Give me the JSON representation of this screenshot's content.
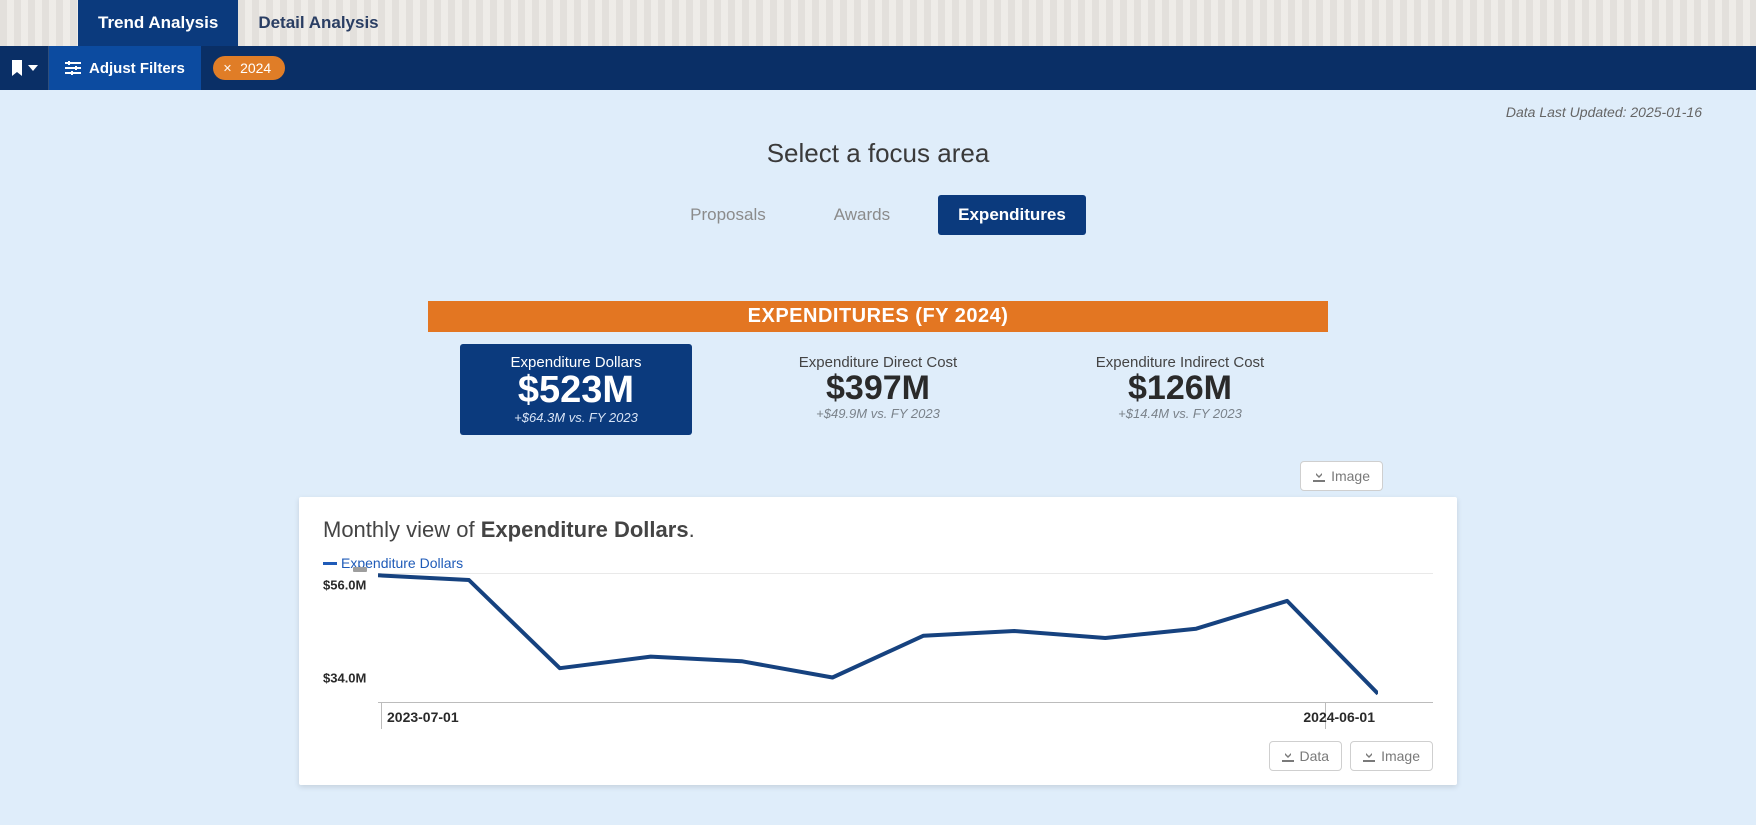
{
  "colors": {
    "navy": "#0b3a7d",
    "orange": "#e37622"
  },
  "tabs": {
    "trend": "Trend Analysis",
    "detail": "Detail Analysis",
    "active": "trend"
  },
  "filterbar": {
    "adjust_label": "Adjust Filters",
    "chips": [
      {
        "label": "2024"
      }
    ]
  },
  "meta": {
    "updated": "Data Last Updated: 2025-01-16"
  },
  "focus": {
    "title": "Select a focus area",
    "tabs": {
      "proposals": "Proposals",
      "awards": "Awards",
      "expenditures": "Expenditures",
      "active": "expenditures"
    }
  },
  "section": {
    "banner": "EXPENDITURES (FY 2024)"
  },
  "kpis": {
    "primary": {
      "label": "Expenditure Dollars",
      "value": "$523M",
      "delta": "+$64.3M vs. FY 2023"
    },
    "direct": {
      "label": "Expenditure Direct Cost",
      "value": "$397M",
      "delta": "+$49.9M vs. FY 2023"
    },
    "indirect": {
      "label": "Expenditure Indirect Cost",
      "value": "$126M",
      "delta": "+$14.4M vs. FY 2023"
    }
  },
  "chart": {
    "title_prefix": "Monthly view of ",
    "title_bold": "Expenditure Dollars",
    "title_suffix": ".",
    "legend": "Expenditure Dollars",
    "y_ticks": [
      "$56.0M",
      "$34.0M"
    ],
    "x_start": "2023-07-01",
    "x_end": "2024-06-01",
    "buttons": {
      "image": "Image",
      "data": "Data"
    }
  },
  "chart_data": {
    "type": "line",
    "title": "Monthly view of Expenditure Dollars",
    "xlabel": "",
    "ylabel": "",
    "ylim": [
      34,
      56
    ],
    "x": [
      "2023-07-01",
      "2023-08-01",
      "2023-09-01",
      "2023-10-01",
      "2023-11-01",
      "2023-12-01",
      "2024-01-01",
      "2024-02-01",
      "2024-03-01",
      "2024-04-01",
      "2024-05-01",
      "2024-06-01"
    ],
    "series": [
      {
        "name": "Expenditure Dollars",
        "values": [
          57.5,
          56.5,
          37.5,
          40.0,
          39.0,
          35.5,
          44.5,
          45.5,
          44.0,
          46.0,
          52.0,
          32.0
        ]
      }
    ]
  }
}
